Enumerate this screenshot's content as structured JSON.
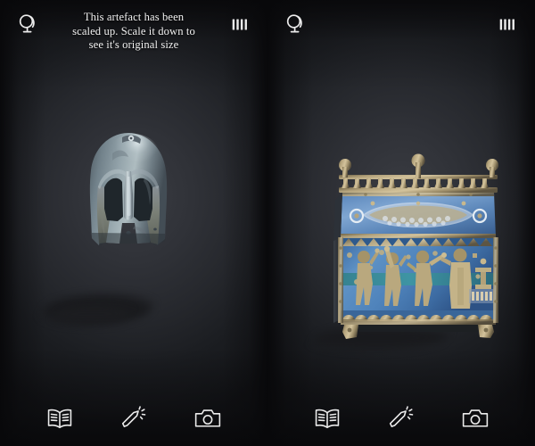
{
  "app": {
    "background_color": "#141518",
    "panel_count": 2
  },
  "panels": [
    {
      "name": "helmet-panel",
      "header": {
        "globe_icon": "globe-on-stand-icon",
        "scale_icon": "scale-bars-icon",
        "hint_line1": "This artefact has been",
        "hint_line2": "scaled up. Scale it down to",
        "hint_line3": "see it's original size",
        "hint_visible": true
      },
      "artifact": {
        "name": "bronze-corinthian-helmet",
        "label": "Bronze Corinthian helmet",
        "body_color": "#7d8a91",
        "shade_color": "#49545c",
        "highlight_color": "#c6d2d6",
        "shadow_color": "#191a1d"
      },
      "toolbar": {
        "book_label": "Read",
        "book_icon": "open-book-icon",
        "wand_label": "Effects",
        "wand_icon": "magic-wand-icon",
        "camera_label": "Capture",
        "camera_icon": "camera-icon"
      }
    },
    {
      "name": "casket-panel",
      "header": {
        "globe_icon": "globe-on-stand-icon",
        "scale_icon": "scale-bars-icon",
        "hint_line1": "",
        "hint_line2": "",
        "hint_line3": "",
        "hint_visible": false
      },
      "artifact": {
        "name": "limoges-enamel-reliquary-chasse",
        "label": "Limoges champleve enamel reliquary chasse",
        "enamel_color": "#4d7fb5",
        "enamel_dark": "#2f5a8c",
        "gilt_color": "#b9a882",
        "gilt_dark": "#786a4d",
        "shadow_color": "#191a1d"
      },
      "toolbar": {
        "book_label": "Read",
        "book_icon": "open-book-icon",
        "wand_label": "Effects",
        "wand_icon": "magic-wand-icon",
        "camera_label": "Capture",
        "camera_icon": "camera-icon"
      }
    }
  ],
  "colors": {
    "icon": "#ececec",
    "text": "#f2f2f2",
    "backdrop_center": "#3a3c42",
    "backdrop_edge": "#131417"
  }
}
